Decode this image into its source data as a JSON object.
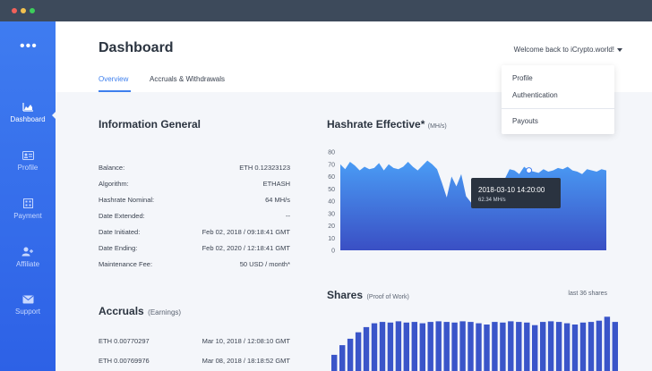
{
  "window": {
    "dots": [
      "#f1615a",
      "#f2c14f",
      "#3ccd5b"
    ]
  },
  "sidebar": {
    "menu_glyph": "•••",
    "items": [
      {
        "label": "Dashboard",
        "icon": "area-chart-icon",
        "active": true
      },
      {
        "label": "Profile",
        "icon": "id-card-icon",
        "active": false
      },
      {
        "label": "Payment",
        "icon": "payment-icon",
        "active": false
      },
      {
        "label": "Affiliate",
        "icon": "user-plus-icon",
        "active": false
      },
      {
        "label": "Support",
        "icon": "envelope-icon",
        "active": false
      }
    ]
  },
  "header": {
    "title": "Dashboard",
    "welcome": "Welcome back to iCrypto.world!",
    "tabs": [
      "Overview",
      "Accruals & Withdrawals"
    ]
  },
  "dropdown": {
    "items": [
      "Profile",
      "Authentication",
      "Payouts"
    ]
  },
  "info": {
    "title": "Information General",
    "rows": [
      {
        "label": "Balance:",
        "value": "ETH 0.12323123"
      },
      {
        "label": "Algorithm:",
        "value": "ETHASH"
      },
      {
        "label": "Hashrate Nominal:",
        "value": "64 MH/s"
      },
      {
        "label": "Date Extended:",
        "value": "--"
      },
      {
        "label": "Date Initiated:",
        "value": "Feb 02, 2018 / 09:18:41 GMT"
      },
      {
        "label": "Date Ending:",
        "value": "Feb 02, 2020 / 12:18:41 GMT"
      },
      {
        "label": "Maintenance Fee:",
        "value": "50 USD / month*"
      }
    ]
  },
  "accruals": {
    "title": "Accruals",
    "subtitle": "(Earnings)",
    "rows": [
      {
        "amount": "ETH 0.00770297",
        "date": "Mar 10, 2018 / 12:08:10 GMT"
      },
      {
        "amount": "ETH 0.00769976",
        "date": "Mar 08, 2018 / 18:18:52 GMT"
      }
    ]
  },
  "hashrate_chart_title": "Hashrate Effective*",
  "hashrate_chart_unit": "(MH/s)",
  "tooltip": {
    "date": "2018-03-10 14:20:00",
    "value": "62.34 MH/s"
  },
  "shares_title": "Shares",
  "shares_subtitle": "(Proof of Work)",
  "shares_caption": "last 36 shares",
  "chart_data": [
    {
      "type": "area",
      "title": "Hashrate Effective*",
      "ylabel": "(MH/s)",
      "ylim": [
        0,
        80
      ],
      "yticks": [
        0,
        10,
        20,
        30,
        40,
        50,
        60,
        70,
        80
      ],
      "grid": false,
      "values": [
        70,
        66,
        72,
        69,
        65,
        68,
        66,
        67,
        71,
        65,
        70,
        67,
        66,
        68,
        72,
        68,
        65,
        69,
        73,
        70,
        66,
        55,
        43,
        60,
        52,
        62,
        44,
        39,
        35,
        38,
        42,
        40,
        46,
        50,
        58,
        66,
        65,
        62,
        68,
        65,
        64,
        63,
        66,
        64,
        65,
        67,
        66,
        68,
        65,
        64,
        62,
        66,
        65,
        64,
        66,
        65
      ],
      "color": "#3f7cf0"
    },
    {
      "type": "bar",
      "title": "Shares",
      "values": [
        0.25,
        0.4,
        0.5,
        0.6,
        0.68,
        0.74,
        0.76,
        0.75,
        0.77,
        0.75,
        0.76,
        0.74,
        0.76,
        0.77,
        0.76,
        0.75,
        0.77,
        0.76,
        0.74,
        0.72,
        0.76,
        0.75,
        0.77,
        0.76,
        0.75,
        0.71,
        0.76,
        0.77,
        0.76,
        0.74,
        0.72,
        0.75,
        0.76,
        0.78,
        0.84,
        0.76
      ],
      "color": "#3a55c9"
    }
  ]
}
